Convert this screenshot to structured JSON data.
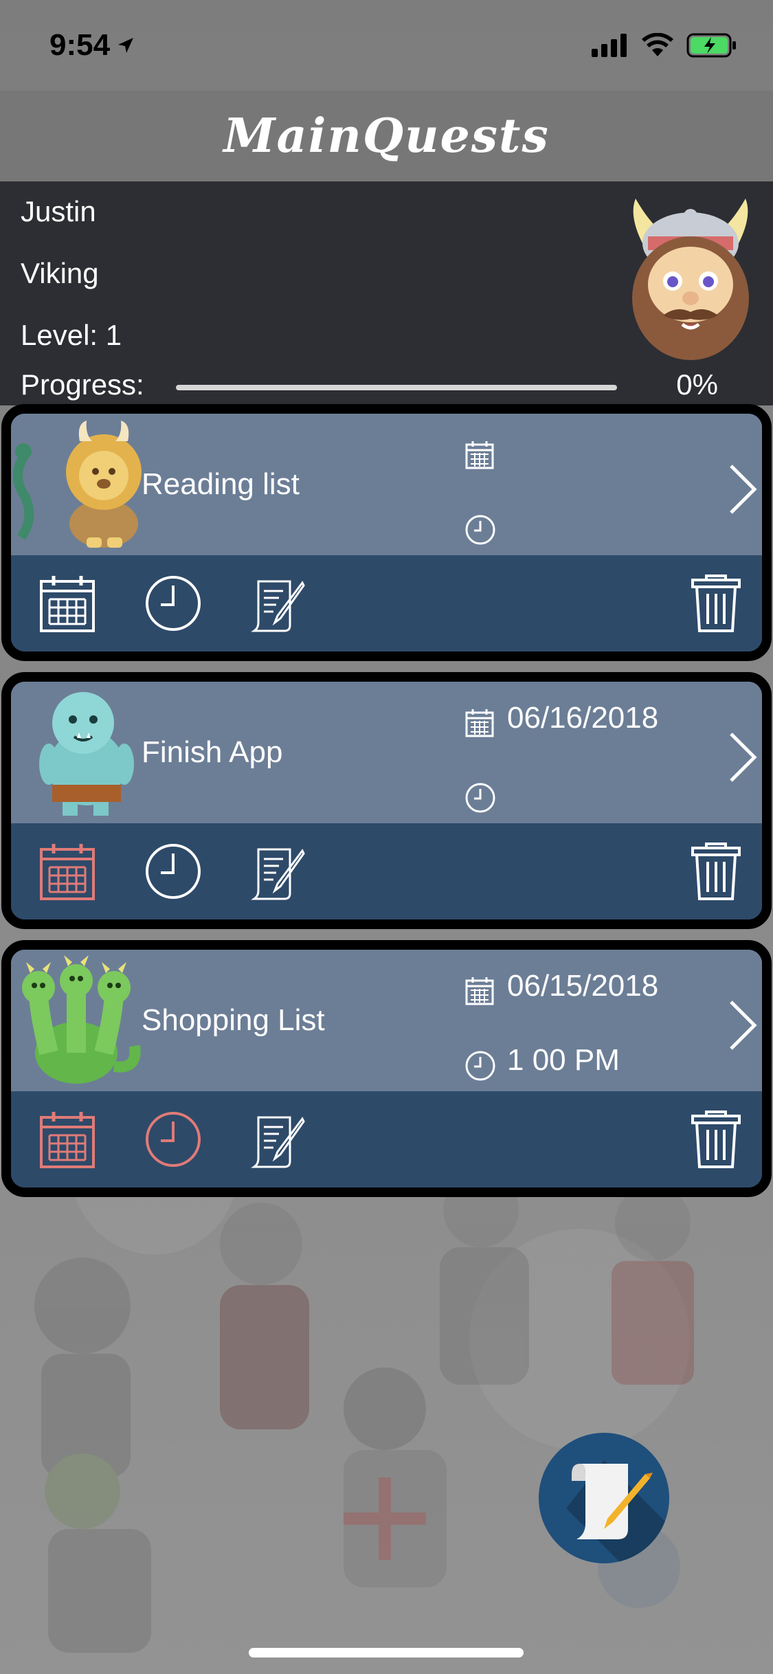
{
  "status_bar": {
    "time": "9:54"
  },
  "app_title": "MainQuests",
  "profile": {
    "name": "Justin",
    "class": "Viking",
    "level": "Level: 1",
    "progress_label": "Progress:",
    "progress_value": "0%",
    "progress_fraction": 0
  },
  "quests": [
    {
      "title": "Reading list",
      "date": "",
      "time": "",
      "calendar_color": "#ffffff",
      "clock_color": "#ffffff"
    },
    {
      "title": "Finish App",
      "date": "06/16/2018",
      "time": "",
      "calendar_color": "#e07b78",
      "clock_color": "#ffffff"
    },
    {
      "title": "Shopping List",
      "date": "06/15/2018",
      "time": "1 00 PM",
      "calendar_color": "#e07b78",
      "clock_color": "#e07b78"
    }
  ],
  "colors": {
    "header_dark": "#2c2e33",
    "card_top": "#6c7e96",
    "card_bottom": "#2e4a69",
    "accent_due": "#e07b78",
    "fab": "#1f4f7b"
  },
  "icons": {
    "quest_icons": [
      "lion-icon",
      "ogre-icon",
      "hydra-icon"
    ],
    "avatar": "viking-avatar",
    "fab": "new-quest-scroll-icon"
  }
}
